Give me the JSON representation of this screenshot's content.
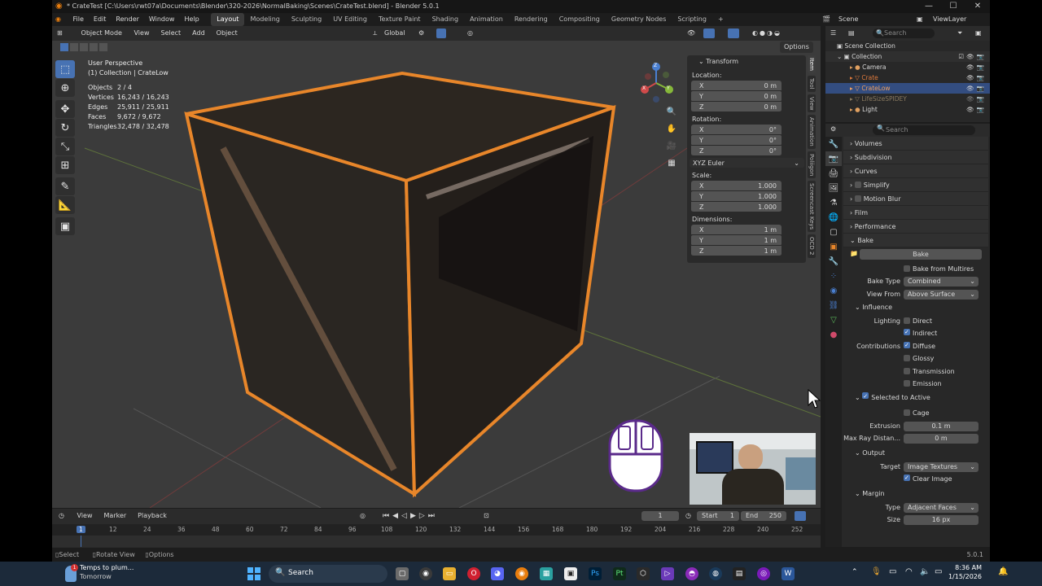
{
  "window": {
    "title": "* CrateTest [C:\\Users\\rwt07a\\Documents\\Blender\\320-2026\\NormalBaking\\Scenes\\CrateTest.blend] - Blender 5.0.1",
    "minimize": "—",
    "maximize": "☐",
    "close": "✕"
  },
  "menu": {
    "items": [
      "File",
      "Edit",
      "Render",
      "Window",
      "Help"
    ],
    "workspaces": [
      "Layout",
      "Modeling",
      "Sculpting",
      "UV Editing",
      "Texture Paint",
      "Shading",
      "Animation",
      "Rendering",
      "Compositing",
      "Geometry Nodes",
      "Scripting"
    ],
    "add_workspace": "+",
    "scene_label": "Scene",
    "viewlayer_label": "ViewLayer"
  },
  "viewport": {
    "mode": "Object Mode",
    "menus": [
      "View",
      "Select",
      "Add",
      "Object"
    ],
    "orientation": "Global",
    "options": "Options",
    "perspective": "User Perspective",
    "collection_path": "(1) Collection | CrateLow",
    "stats": [
      {
        "label": "Objects",
        "value": "2 / 4"
      },
      {
        "label": "Vertices",
        "value": "16,243 / 16,243"
      },
      {
        "label": "Edges",
        "value": "25,911 / 25,911"
      },
      {
        "label": "Faces",
        "value": "9,672 / 9,672"
      },
      {
        "label": "Triangles",
        "value": "32,478 / 32,478"
      }
    ],
    "gizmo": {
      "x": "X",
      "y": "Y",
      "z": "Z"
    }
  },
  "npanel": {
    "title": "Transform",
    "location_label": "Location:",
    "location": [
      {
        "axis": "X",
        "value": "0 m"
      },
      {
        "axis": "Y",
        "value": "0 m"
      },
      {
        "axis": "Z",
        "value": "0 m"
      }
    ],
    "rotation_label": "Rotation:",
    "rotation": [
      {
        "axis": "X",
        "value": "0°"
      },
      {
        "axis": "Y",
        "value": "0°"
      },
      {
        "axis": "Z",
        "value": "0°"
      }
    ],
    "rotation_mode": "XYZ Euler",
    "scale_label": "Scale:",
    "scale": [
      {
        "axis": "X",
        "value": "1.000"
      },
      {
        "axis": "Y",
        "value": "1.000"
      },
      {
        "axis": "Z",
        "value": "1.000"
      }
    ],
    "dimensions_label": "Dimensions:",
    "dimensions": [
      {
        "axis": "X",
        "value": "1 m"
      },
      {
        "axis": "Y",
        "value": "1 m"
      },
      {
        "axis": "Z",
        "value": "1 m"
      }
    ],
    "tabs": [
      "Item",
      "Tool",
      "View",
      "Animation",
      "Poliigon",
      "Screencast Keys",
      "OCD 2"
    ]
  },
  "outliner": {
    "search_placeholder": "Search",
    "scene_collection": "Scene Collection",
    "collection": "Collection",
    "items": [
      {
        "name": "Camera",
        "color": "#e0a060"
      },
      {
        "name": "Crate",
        "color": "#e07a3c"
      },
      {
        "name": "CrateLow",
        "color": "#e07a3c"
      },
      {
        "name": "LifeSizeSPIDEY",
        "color": "#9a8a6a"
      },
      {
        "name": "Light",
        "color": "#e0a060"
      }
    ]
  },
  "properties": {
    "search_placeholder": "Search",
    "sections": [
      "Volumes",
      "Subdivision",
      "Curves",
      "Simplify",
      "Motion Blur",
      "Film",
      "Performance",
      "Bake"
    ],
    "bake_button": "Bake",
    "bake_from_multires": "Bake from Multires",
    "bake_type_label": "Bake Type",
    "bake_type": "Combined",
    "view_from_label": "View From",
    "view_from": "Above Surface",
    "influence": "Influence",
    "lighting_label": "Lighting",
    "direct": "Direct",
    "indirect": "Indirect",
    "contributions_label": "Contributions",
    "diffuse": "Diffuse",
    "glossy": "Glossy",
    "transmission": "Transmission",
    "emission": "Emission",
    "selected_to_active": "Selected to Active",
    "cage": "Cage",
    "extrusion_label": "Extrusion",
    "extrusion": "0.1 m",
    "max_ray_label": "Max Ray Distan...",
    "max_ray": "0 m",
    "output": "Output",
    "target_label": "Target",
    "target": "Image Textures",
    "clear_image": "Clear Image",
    "margin": "Margin",
    "type_label": "Type",
    "type": "Adjacent Faces",
    "size_label": "Size",
    "size": "16 px"
  },
  "timeline": {
    "menus": [
      "View",
      "Marker",
      "Playback"
    ],
    "current_frame": "1",
    "start_label": "Start",
    "start": "1",
    "end_label": "End",
    "end": "250",
    "ticks": [
      "1",
      "12",
      "24",
      "36",
      "48",
      "60",
      "72",
      "84",
      "96",
      "108",
      "120",
      "132",
      "144",
      "156",
      "168",
      "180",
      "192",
      "204",
      "216",
      "228",
      "240",
      "252"
    ]
  },
  "status": {
    "select": "Select",
    "rotate_view": "Rotate View",
    "options": "Options",
    "version": "5.0.1"
  },
  "taskbar": {
    "weather_line1": "Temps to plum...",
    "weather_line2": "Tomorrow",
    "weather_badge": "1",
    "search": "Search",
    "time": "8:36 AM",
    "date": "1/15/2026",
    "apps": [
      "Ps",
      "Pt",
      "W"
    ]
  }
}
